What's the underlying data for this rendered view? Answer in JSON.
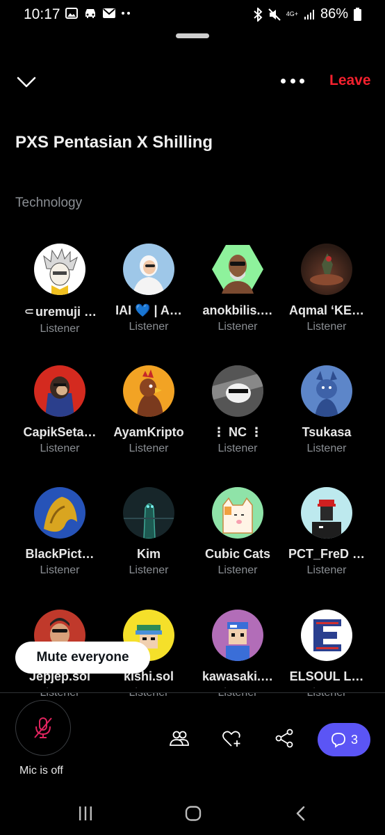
{
  "status_bar": {
    "time": "10:17",
    "battery": "86%",
    "network": "4G+"
  },
  "header": {
    "leave_label": "Leave"
  },
  "space": {
    "title": "PXS Pentasian X Shilling",
    "topic": "Technology"
  },
  "participants": [
    {
      "name": "⸦uremuji …",
      "role": "Listener",
      "avatar_color": "#ffffff",
      "emoji": "👨‍🎨"
    },
    {
      "name": "IAI 💙 | A…",
      "role": "Listener",
      "avatar_color": "#9ec7e8",
      "emoji": "🎨"
    },
    {
      "name": "anokbilis.…",
      "role": "Listener",
      "avatar_color": "#8ef29c"
    },
    {
      "name": "Aqmal ‘KE…",
      "role": "Listener",
      "avatar_color": "#3a2a24"
    },
    {
      "name": "CapikSeta…",
      "role": "Listener",
      "avatar_color": "#d42a1f"
    },
    {
      "name": "AyamKripto",
      "role": "Listener",
      "avatar_color": "#f2a324"
    },
    {
      "name": "⋮ NC ⋮",
      "role": "Listener",
      "avatar_color": "#3c3c3c"
    },
    {
      "name": "Tsukasa",
      "role": "Listener",
      "avatar_color": "#5d86c9"
    },
    {
      "name": "BlackPict…",
      "role": "Listener",
      "avatar_color": "#2653b8"
    },
    {
      "name": "Kim",
      "role": "Listener",
      "avatar_color": "#17262a"
    },
    {
      "name": "Cubic Cats",
      "role": "Listener",
      "avatar_color": "#8fe3a8"
    },
    {
      "name": "PCT_FreD …",
      "role": "Listener",
      "avatar_color": "#bde9ee"
    },
    {
      "name": "Jepjep.sol",
      "role": "Listener",
      "avatar_color": "#c0392b"
    },
    {
      "name": "kishi.sol",
      "role": "Listener",
      "avatar_color": "#f5e02a"
    },
    {
      "name": "kawasaki.…",
      "role": "Listener",
      "avatar_color": "#b26db8"
    },
    {
      "name": "ELSOUL L…",
      "role": "Listener",
      "avatar_color": "#ffffff"
    }
  ],
  "mute_everyone_label": "Mute everyone",
  "mic": {
    "label": "Mic is off"
  },
  "chat": {
    "count": "3"
  },
  "colors": {
    "accent": "#5b55f5",
    "leave": "#f4212e",
    "muted_text": "#8b8f94"
  }
}
